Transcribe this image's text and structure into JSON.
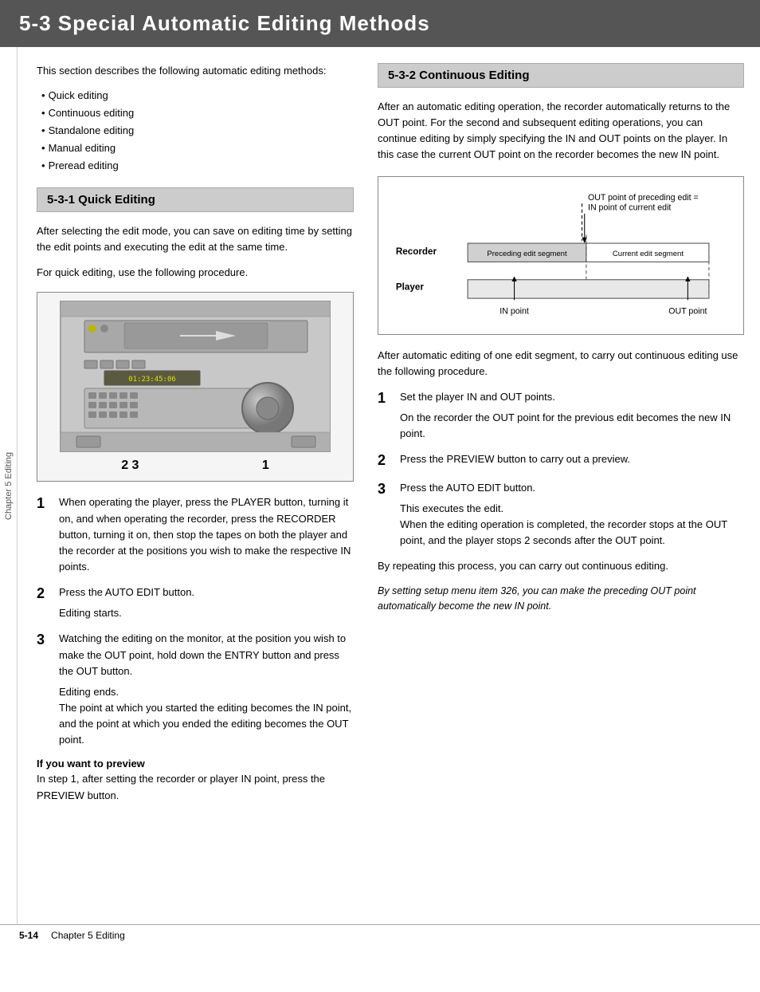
{
  "header": {
    "title": "5-3   Special Automatic Editing Methods"
  },
  "sidebar": {
    "label": "Chapter 5  Editing"
  },
  "left": {
    "intro": "This section describes the following automatic editing methods:",
    "bullets": [
      "Quick editing",
      "Continuous editing",
      "Standalone editing",
      "Manual editing",
      "Preread editing"
    ],
    "section531": {
      "heading": "5-3-1  Quick Editing",
      "para1": "After selecting the edit mode, you can save on editing time by setting the edit points and executing the edit at the same time.",
      "para2": "For quick editing, use the following procedure.",
      "diagram_labels": [
        "2 3",
        "1"
      ],
      "steps": [
        {
          "num": "1",
          "text": "When operating the player, press the PLAYER button, turning it on, and when operating the recorder, press the RECORDER button, turning it on, then stop the tapes on both the player and the recorder at the positions you wish to make the respective IN points."
        },
        {
          "num": "2",
          "text": "Press the AUTO EDIT button.",
          "sub": "Editing starts."
        },
        {
          "num": "3",
          "text": "Watching the editing on the monitor, at the position you wish to make the OUT point, hold down the ENTRY button and press the OUT button.",
          "sub": "Editing ends.\nThe point at which you started the editing becomes the IN point, and the point at which you ended the editing becomes the OUT point."
        }
      ],
      "preview_heading": "If you want to preview",
      "preview_text": "In step 1, after setting the recorder or player IN point, press the PREVIEW button."
    }
  },
  "right": {
    "section532": {
      "heading": "5-3-2  Continuous Editing",
      "para1": "After an automatic editing operation, the recorder automatically returns to the OUT point.  For the second and subsequent editing operations, you can continue editing by simply specifying the IN and OUT points on the player.  In this case the current OUT point on the recorder becomes the new IN point.",
      "diagram": {
        "out_label": "OUT point of preceding edit =\nIN point of current edit",
        "recorder_label": "Recorder",
        "preceding_segment": "Preceding edit segment",
        "current_segment": "Current edit segment",
        "player_label": "Player",
        "in_point": "IN point",
        "out_point": "OUT point"
      },
      "para2": "After automatic editing of one edit segment, to carry out continuous editing use the following procedure.",
      "steps": [
        {
          "num": "1",
          "text": "Set the player IN and OUT points.",
          "sub": "On the recorder the OUT point for the previous edit becomes the new IN point."
        },
        {
          "num": "2",
          "text": "Press the PREVIEW button to carry out a preview."
        },
        {
          "num": "3",
          "text": "Press the AUTO EDIT button.",
          "sub": "This executes the edit.\nWhen the editing operation is completed, the recorder stops at the OUT point, and the player stops 2 seconds after the OUT point."
        }
      ],
      "para3": "By repeating this process, you can carry out continuous editing.",
      "italic_note": "By setting setup menu item 326, you can make the preceding OUT point automatically become the new IN point."
    }
  },
  "footer": {
    "page_num": "5-14",
    "chapter": "Chapter 5  Editing"
  }
}
